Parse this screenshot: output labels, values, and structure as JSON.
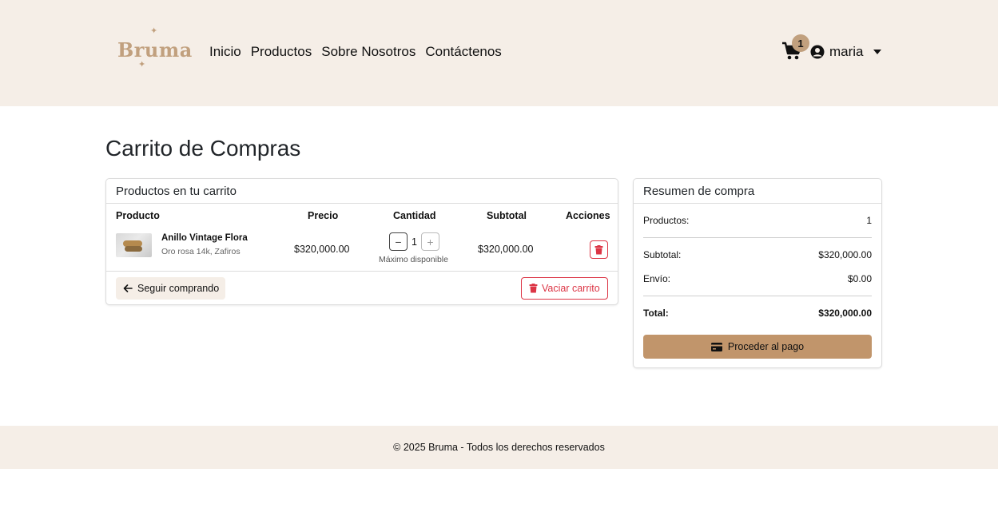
{
  "header": {
    "logo_text": "Bruma",
    "nav": [
      "Inicio",
      "Productos",
      "Sobre Nosotros",
      "Contáctenos"
    ],
    "cart_count": "1",
    "user_name": "maria"
  },
  "page": {
    "title": "Carrito de Compras"
  },
  "cart": {
    "title": "Productos en tu carrito",
    "columns": [
      "Producto",
      "Precio",
      "Cantidad",
      "Subtotal",
      "Acciones"
    ],
    "items": [
      {
        "name": "Anillo Vintage Flora",
        "description": "Oro rosa 14k, Zafiros",
        "price": "$320,000.00",
        "quantity": "1",
        "quantity_note": "Máximo disponible",
        "subtotal": "$320,000.00"
      }
    ],
    "continue_label": "Seguir comprando",
    "empty_label": "Vaciar carrito"
  },
  "summary": {
    "title": "Resumen de compra",
    "products_label": "Productos:",
    "products_value": "1",
    "subtotal_label": "Subtotal:",
    "subtotal_value": "$320,000.00",
    "shipping_label": "Envío:",
    "shipping_value": "$0.00",
    "total_label": "Total:",
    "total_value": "$320,000.00",
    "pay_label": "Proceder al pago"
  },
  "footer": {
    "text": "© 2025 Bruma - Todos los derechos reservados"
  },
  "colors": {
    "header_bg": "#f5eee7",
    "brand": "#c1a07e",
    "pay_button": "#c1956b",
    "danger": "#dc3545"
  }
}
